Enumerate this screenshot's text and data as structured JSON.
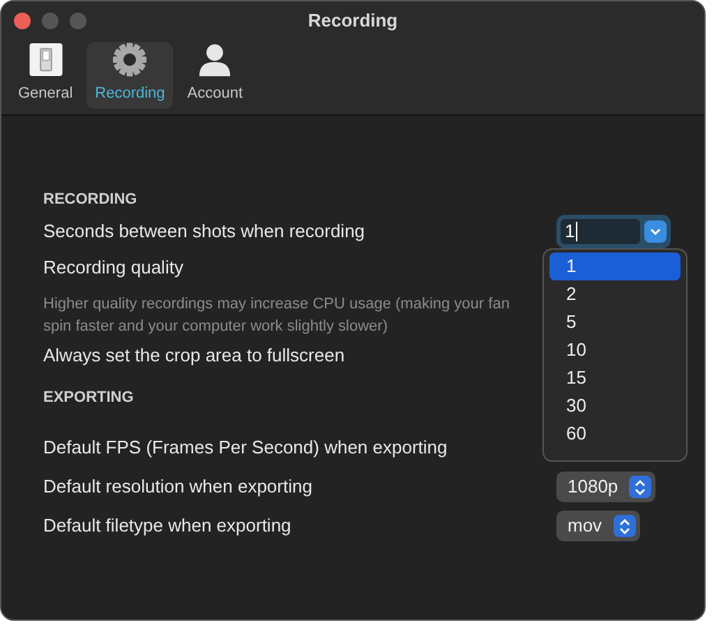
{
  "window": {
    "title": "Recording"
  },
  "toolbar": [
    {
      "kind": "general",
      "label": "General",
      "selected": false
    },
    {
      "kind": "recording",
      "label": "Recording",
      "selected": true
    },
    {
      "kind": "account",
      "label": "Account",
      "selected": false
    }
  ],
  "sections": [
    {
      "heading": "RECORDING",
      "rows": [
        {
          "kind": "combo",
          "label": "Seconds between shots when recording",
          "value": "1"
        },
        {
          "kind": "plain",
          "label": "Recording quality"
        },
        {
          "kind": "note",
          "lines": [
            "Higher quality recordings may increase CPU usage (making your fan",
            "spin faster and your computer work slightly slower)"
          ]
        },
        {
          "kind": "plain",
          "label": "Always set the crop area to fullscreen"
        }
      ]
    },
    {
      "heading": "EXPORTING",
      "rows": [
        {
          "kind": "plain",
          "label": "Default FPS (Frames Per Second) when exporting"
        },
        {
          "kind": "popup",
          "label": "Default resolution when exporting",
          "value": "1080p"
        },
        {
          "kind": "popup",
          "label": "Default filetype when exporting",
          "value": "mov"
        }
      ]
    }
  ],
  "dropdown_menu": {
    "items": [
      {
        "label": "1",
        "selected": true
      },
      {
        "label": "2",
        "selected": false
      },
      {
        "label": "5",
        "selected": false
      },
      {
        "label": "10",
        "selected": false
      },
      {
        "label": "15",
        "selected": false
      },
      {
        "label": "30",
        "selected": false
      },
      {
        "label": "60",
        "selected": false
      }
    ]
  }
}
